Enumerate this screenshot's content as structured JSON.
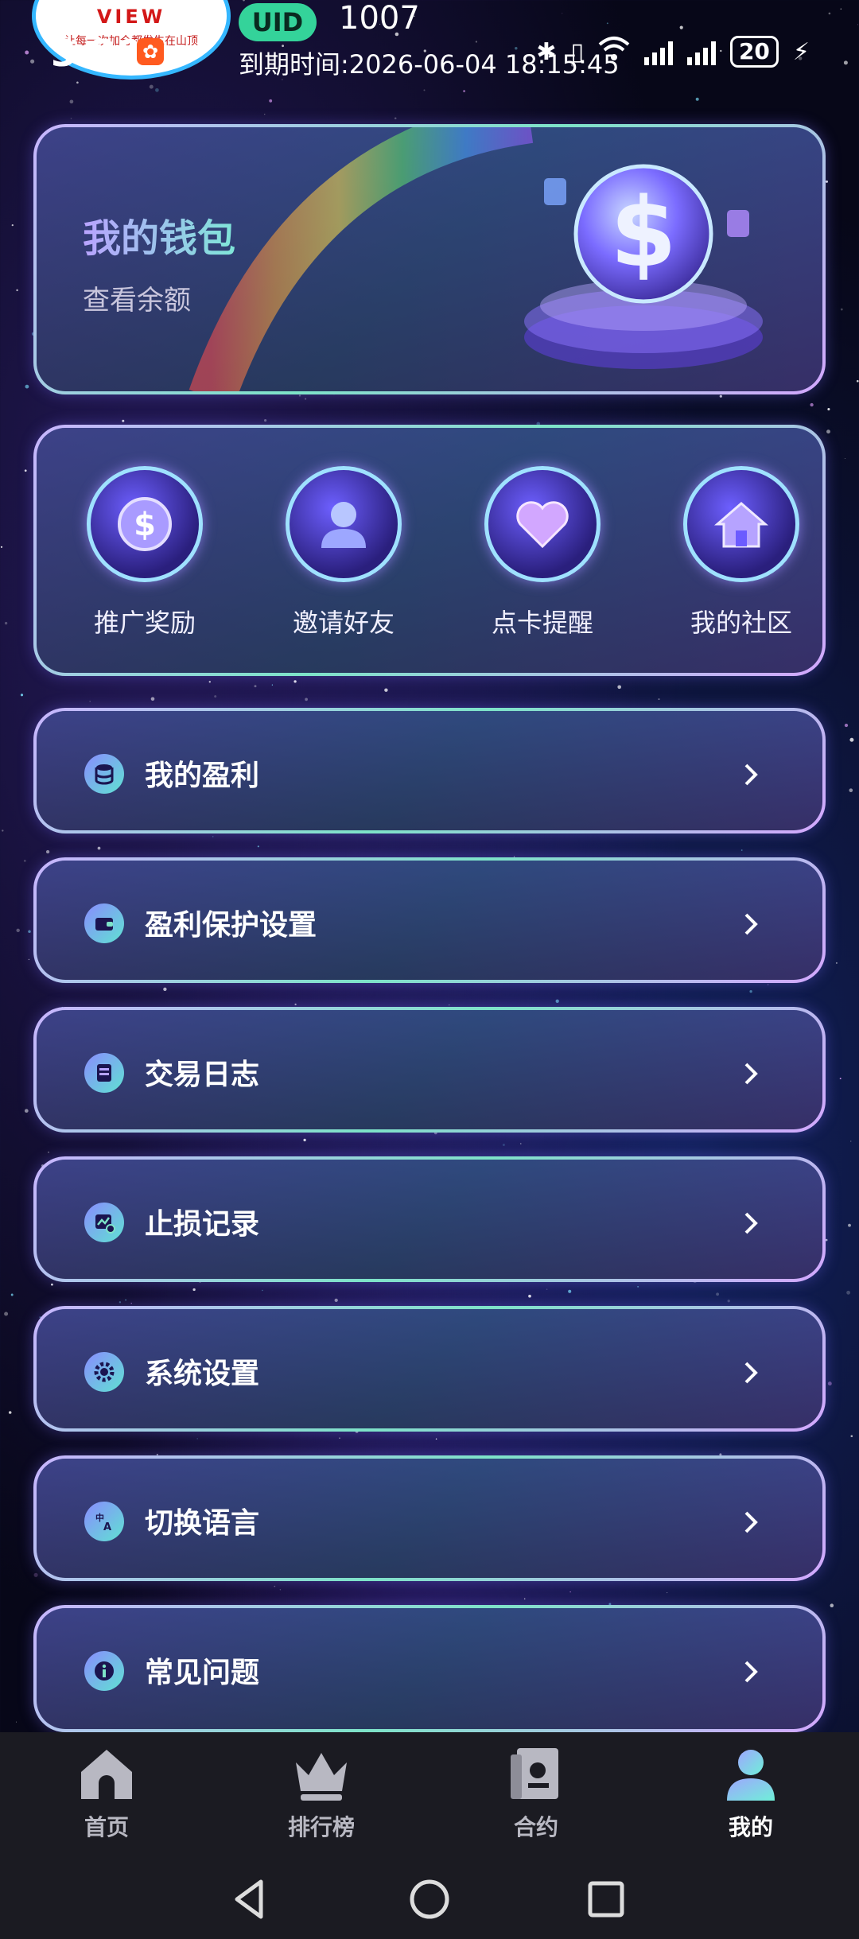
{
  "status_bar": {
    "time": "3:20",
    "uid_label": "UID",
    "uid_value": "1007",
    "expire_text": "到期时间:2026-06-04 18:15:45",
    "battery": "20",
    "view_badge": "VIEW",
    "view_badge_sub": "让每一次加仓都发生在山顶"
  },
  "wallet": {
    "title": "我的钱包",
    "subtitle": "查看余额"
  },
  "shortcuts": [
    {
      "label": "推广奖励",
      "icon": "coin-icon"
    },
    {
      "label": "邀请好友",
      "icon": "user-icon"
    },
    {
      "label": "点卡提醒",
      "icon": "heart-icon"
    },
    {
      "label": "我的社区",
      "icon": "home-icon"
    }
  ],
  "menu": [
    {
      "label": "我的盈利",
      "icon": "database-icon"
    },
    {
      "label": "盈利保护设置",
      "icon": "wallet-icon"
    },
    {
      "label": "交易日志",
      "icon": "log-icon"
    },
    {
      "label": "止损记录",
      "icon": "chart-record-icon"
    },
    {
      "label": "系统设置",
      "icon": "gear-icon"
    },
    {
      "label": "切换语言",
      "icon": "translate-icon"
    },
    {
      "label": "常见问题",
      "icon": "info-icon"
    }
  ],
  "bottom_nav": [
    {
      "label": "首页",
      "icon": "home-icon",
      "active": false
    },
    {
      "label": "排行榜",
      "icon": "crown-icon",
      "active": false
    },
    {
      "label": "合约",
      "icon": "contract-icon",
      "active": false
    },
    {
      "label": "我的",
      "icon": "profile-icon",
      "active": true
    }
  ],
  "colors": {
    "accent_teal": "#7de3c8",
    "accent_purple": "#b9a3ff",
    "uid_pill": "#34d39a",
    "nav_bg": "#1b1b22"
  }
}
